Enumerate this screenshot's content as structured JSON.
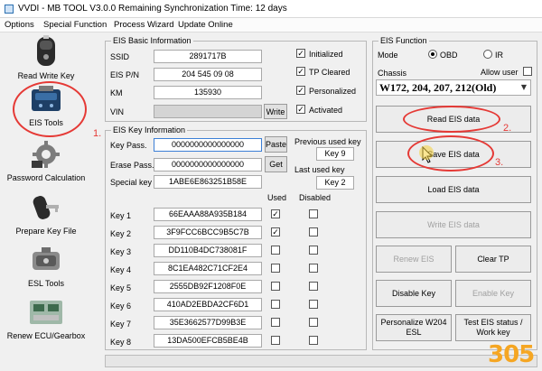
{
  "window": {
    "title": "VVDI - MB TOOL V3.0.0   Remaining Synchronization Time: 12 days"
  },
  "menu": [
    "Options",
    "Special Function",
    "Process Wizard",
    "Update Online"
  ],
  "sidebar": {
    "items": [
      {
        "label": "Read Write Key",
        "icon": "key-fob-icon"
      },
      {
        "label": "EIS Tools",
        "icon": "ecu-module-icon"
      },
      {
        "label": "Password Calculation",
        "icon": "gear-icon"
      },
      {
        "label": "Prepare Key File",
        "icon": "key-icon"
      },
      {
        "label": "ESL Tools",
        "icon": "lock-module-icon"
      },
      {
        "label": "Renew ECU/Gearbox",
        "icon": "circuit-board-icon"
      }
    ]
  },
  "annotations": {
    "n1": "1.",
    "n2": "2.",
    "n3": "3."
  },
  "eis_basic": {
    "title": "EIS Basic Information",
    "ssid_label": "SSID",
    "ssid": "2891717B",
    "pn_label": "EIS P/N",
    "pn": "204 545 09 08",
    "km_label": "KM",
    "km": "135930",
    "vin_label": "VIN",
    "vin": "",
    "write_label": "Write",
    "checks": [
      {
        "label": "Initialized",
        "checked": true
      },
      {
        "label": "TP Cleared",
        "checked": true
      },
      {
        "label": "Personalized",
        "checked": true
      },
      {
        "label": "Activated",
        "checked": true
      }
    ]
  },
  "eis_key": {
    "title": "EIS Key Information",
    "keypass_label": "Key Pass.",
    "keypass": "0000000000000000",
    "erase_label": "Erase Pass.",
    "erase": "0000000000000000",
    "special_label": "Special key",
    "special": "1ABE6E863251B58E",
    "paste_label": "Paste",
    "get_label": "Get",
    "prev_used_label": "Previous used key",
    "prev_used": "Key 9",
    "last_used_label": "Last used key",
    "last_used": "Key 2",
    "used_header": "Used",
    "disabled_header": "Disabled",
    "keys": [
      {
        "label": "Key 1",
        "value": "66EAAA88A935B184",
        "used": true,
        "disabled": false
      },
      {
        "label": "Key 2",
        "value": "3F9FCC6BCC9B5C7B",
        "used": true,
        "disabled": false
      },
      {
        "label": "Key 3",
        "value": "DD110B4DC738081F",
        "used": false,
        "disabled": false
      },
      {
        "label": "Key 4",
        "value": "8C1EA482C71CF2E4",
        "used": false,
        "disabled": false
      },
      {
        "label": "Key 5",
        "value": "2555DB92F1208F0E",
        "used": false,
        "disabled": false
      },
      {
        "label": "Key 6",
        "value": "410AD2EBDA2CF6D1",
        "used": false,
        "disabled": false
      },
      {
        "label": "Key 7",
        "value": "35E3662577D99B3E",
        "used": false,
        "disabled": false
      },
      {
        "label": "Key 8",
        "value": "13DA500EFCB5BE4B",
        "used": false,
        "disabled": false
      }
    ]
  },
  "eis_function": {
    "title": "EIS Function",
    "mode_label": "Mode",
    "mode_obd": "OBD",
    "mode_ir": "IR",
    "mode_selected": "OBD",
    "chassis_label": "Chassis",
    "allow_user_label": "Allow user",
    "chassis_value": "W172, 204, 207, 212(Old)",
    "read_eis": "Read EIS data",
    "save_eis": "Save EIS data",
    "load_eis": "Load EIS data",
    "write_eis": "Write EIS data",
    "renew_eis": "Renew EIS",
    "clear_tp": "Clear TP",
    "disable_key": "Disable Key",
    "enable_key": "Enable Key",
    "personalize_1": "Personalize W204",
    "personalize_2": "ESL",
    "test_1": "Test EIS status /",
    "test_2": "Work key"
  },
  "watermark": {
    "text": "305"
  },
  "colors": {
    "annotation_red": "#e53935",
    "progress_green": "#06b025",
    "watermark_orange": "#f5a623"
  },
  "progress": {
    "fraction": 0.0
  }
}
